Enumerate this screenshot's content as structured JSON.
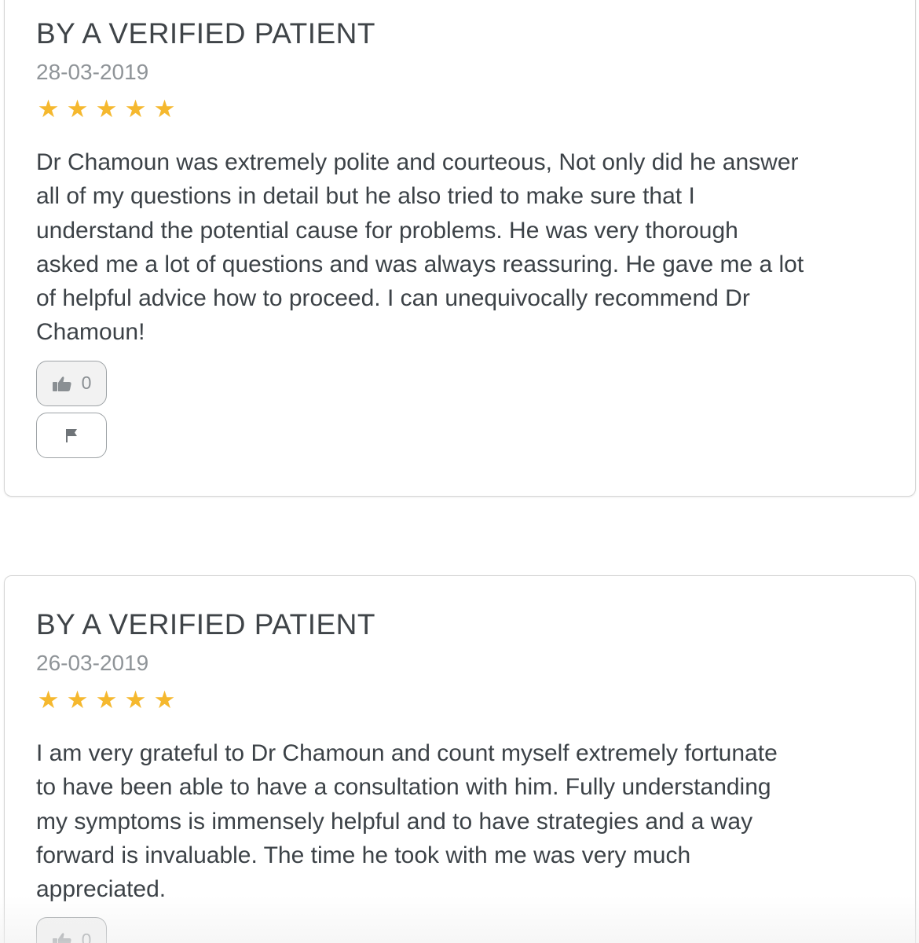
{
  "reviews": [
    {
      "author": "BY A VERIFIED PATIENT",
      "date": "28-03-2019",
      "rating": 5,
      "text": "Dr Chamoun was extremely polite and courteous, Not only did he answer\nall of my questions in detail but he also tried to make sure that I\nunderstand the potential cause for problems. He was very thorough\nasked me a lot of questions and was always reassuring. He gave me a lot\nof helpful advice how to proceed. I can unequivocally recommend Dr\nChamoun!",
      "likes": "0"
    },
    {
      "author": "BY A VERIFIED PATIENT",
      "date": "26-03-2019",
      "rating": 5,
      "text": "I am very grateful to Dr Chamoun and count myself extremely fortunate\nto have been able to have a consultation with him. Fully understanding\nmy symptoms is immensely helpful and to have strategies and a way\nforward is invaluable. The time he took with me was very much\nappreciated.",
      "likes": "0"
    }
  ],
  "icons": {
    "star": "star-icon",
    "like": "thumbs-up-icon",
    "flag": "flag-icon"
  },
  "colors": {
    "star": "#f5b82e",
    "text": "#3c4247",
    "date": "#8f9498",
    "border": "#d6d6d6"
  }
}
